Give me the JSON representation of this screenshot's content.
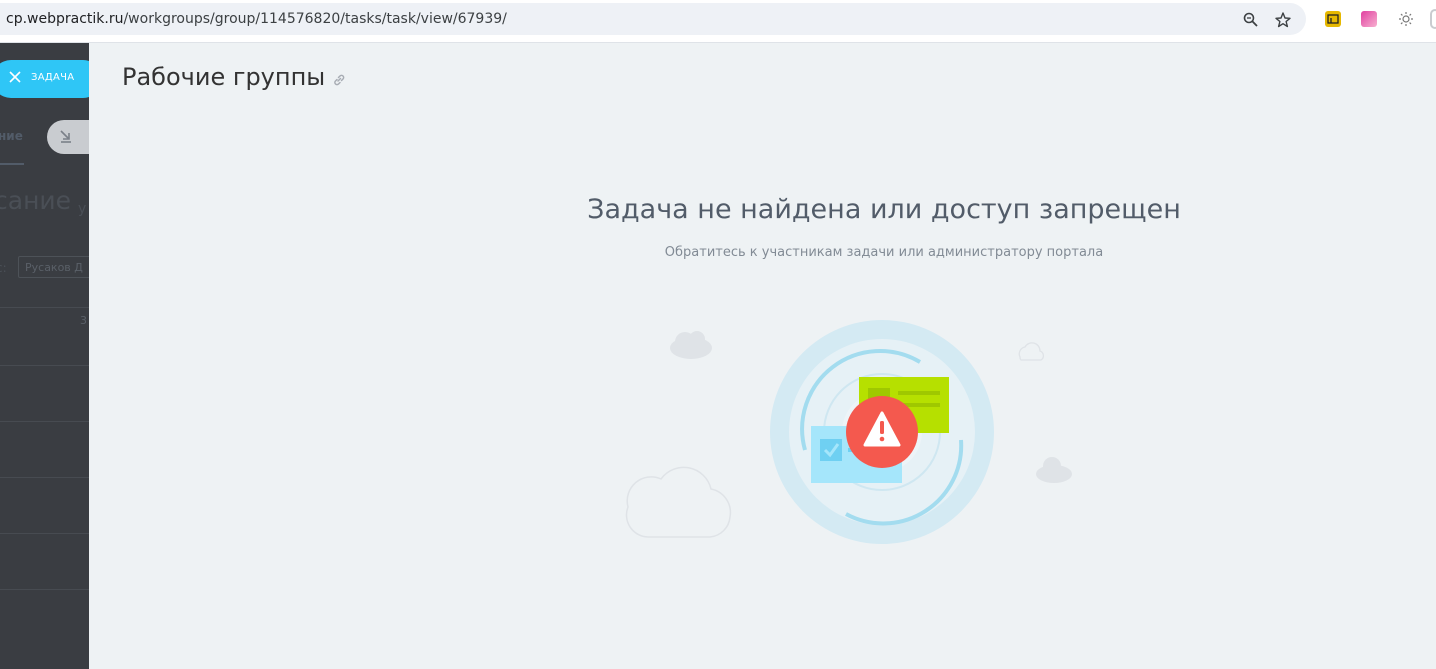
{
  "browser": {
    "url_host": "cp.webpractik.ru",
    "url_path": "/workgroups/group/114576820/tasks/task/view/67939/",
    "icons": [
      "zoom-icon",
      "bookmark-star-icon",
      "extension-icon",
      "extension-icon",
      "extension-icon"
    ]
  },
  "left_panel": {
    "task_button_label": "ЗАДАЧА",
    "tab_label": "ние",
    "title_fragment": "сание",
    "title_fragment2": "у",
    "field_label": "с:",
    "field_value": "Русаков Д",
    "number_fragment": "3"
  },
  "main": {
    "page_title": "Рабочие группы",
    "error_title": "Задача не найдена или доступ запрещен",
    "error_subtitle": "Обратитесь к участникам задачи или администратору портала"
  },
  "colors": {
    "accent": "#2fc6f6",
    "warning": "#f4594e",
    "card_green": "#b6e000",
    "card_blue": "#a5e6fb"
  }
}
